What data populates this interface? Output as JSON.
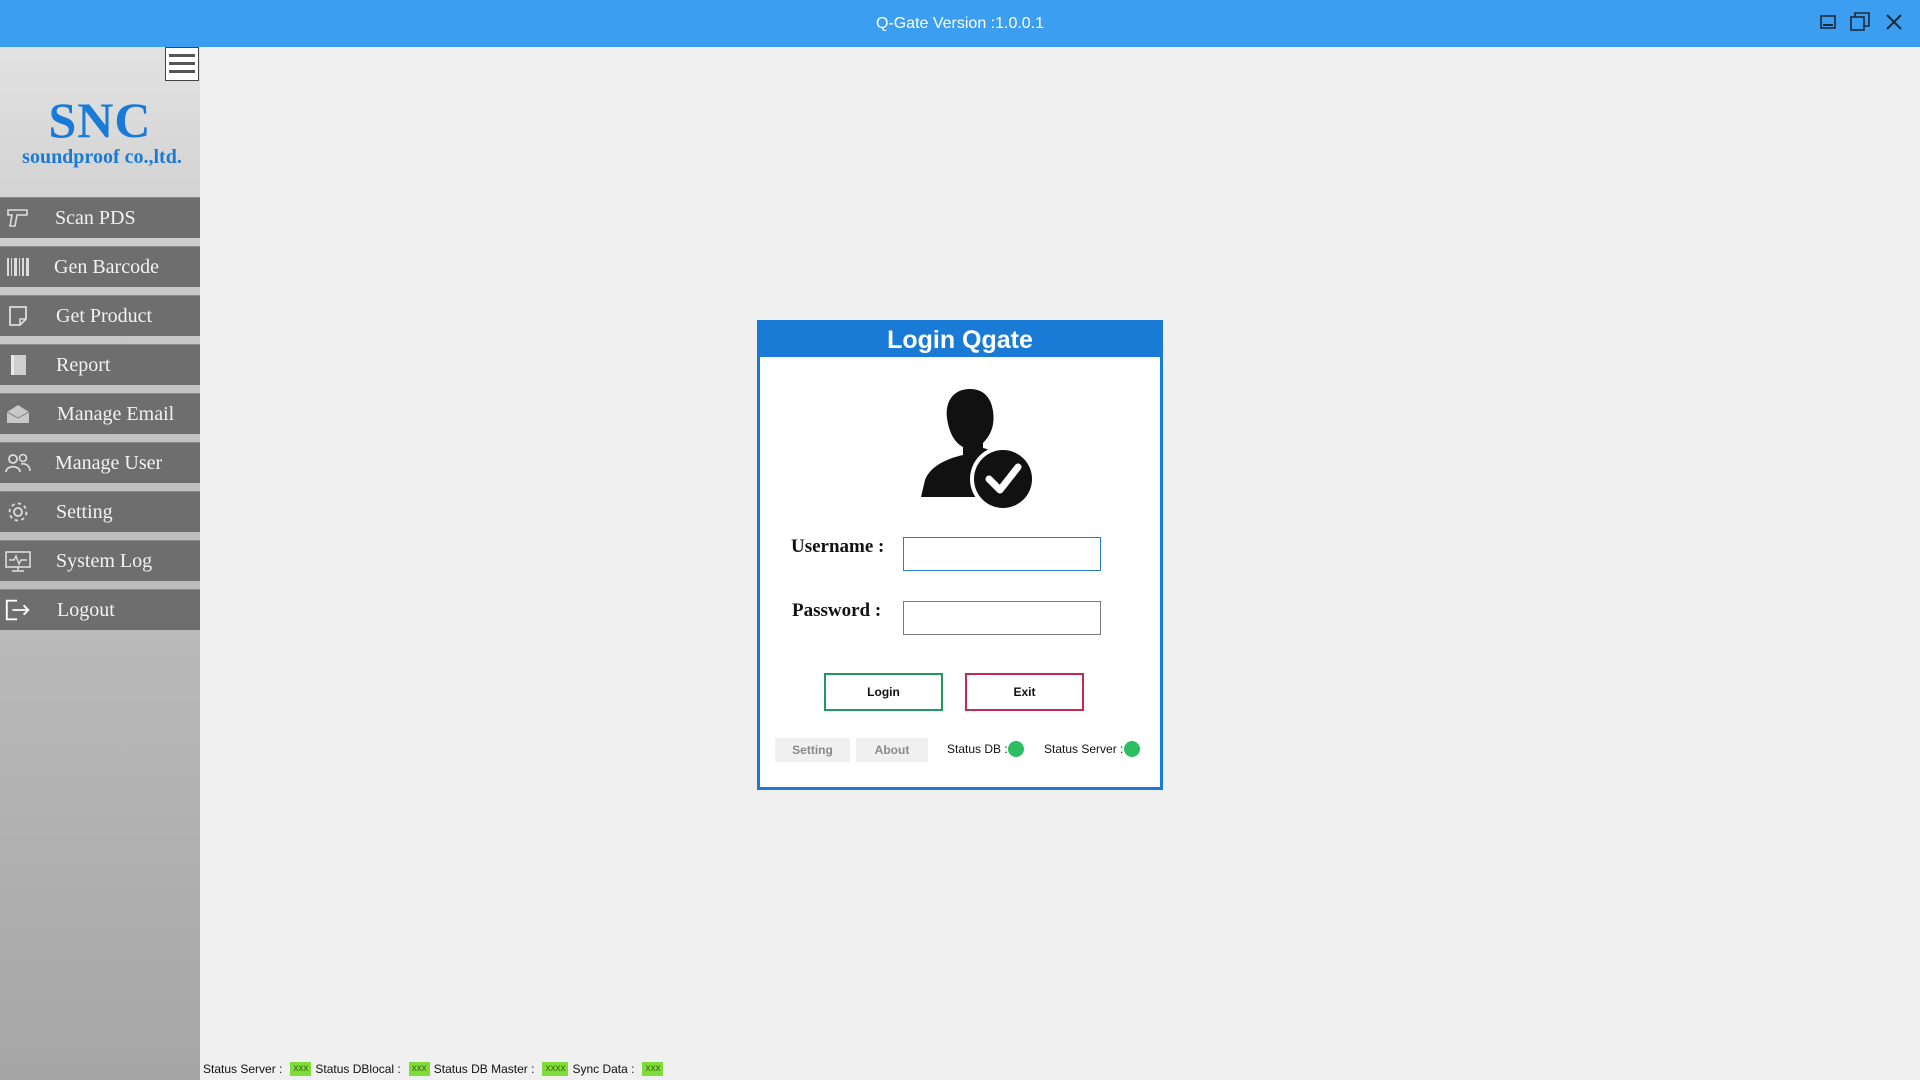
{
  "window": {
    "title": "Q-Gate Version :1.0.0.1",
    "colors": {
      "titlebar": "#3b9ef0",
      "accent": "#1a7bd6"
    },
    "controls": [
      "minimize-icon",
      "restore-icon",
      "close-icon"
    ]
  },
  "sidebar": {
    "logo_big": "SNC",
    "logo_small": "soundproof co.,ltd.",
    "items": [
      {
        "label": "Scan PDS",
        "icon": "barcode-scanner-icon"
      },
      {
        "label": "Gen Barcode",
        "icon": "barcode-icon"
      },
      {
        "label": "Get Product",
        "icon": "document-icon"
      },
      {
        "label": "Report",
        "icon": "report-icon"
      },
      {
        "label": "Manage Email",
        "icon": "email-icon"
      },
      {
        "label": "Manage User",
        "icon": "users-icon"
      },
      {
        "label": "Setting",
        "icon": "gear-icon"
      },
      {
        "label": "System Log",
        "icon": "monitor-icon"
      },
      {
        "label": "Logout",
        "icon": "logout-icon"
      }
    ]
  },
  "login": {
    "title": "Login Qgate",
    "username_label": "Username :",
    "username_value": "",
    "password_label": "Password :",
    "password_value": "",
    "login_button": "Login",
    "exit_button": "Exit",
    "setting_tab": "Setting",
    "about_tab": "About",
    "status_db_label": "Status DB :",
    "status_server_label": "Status Server :",
    "status_color": "#2dbd62"
  },
  "statusbar": {
    "server_label": "Status Server :",
    "server_value": "xxx",
    "dblocal_label": "Status DBlocal :",
    "dblocal_value": "xxx",
    "dbmaster_label": "Status DB Master :",
    "dbmaster_value": "xxxx",
    "sync_label": "Sync Data :",
    "sync_value": "xxx"
  }
}
